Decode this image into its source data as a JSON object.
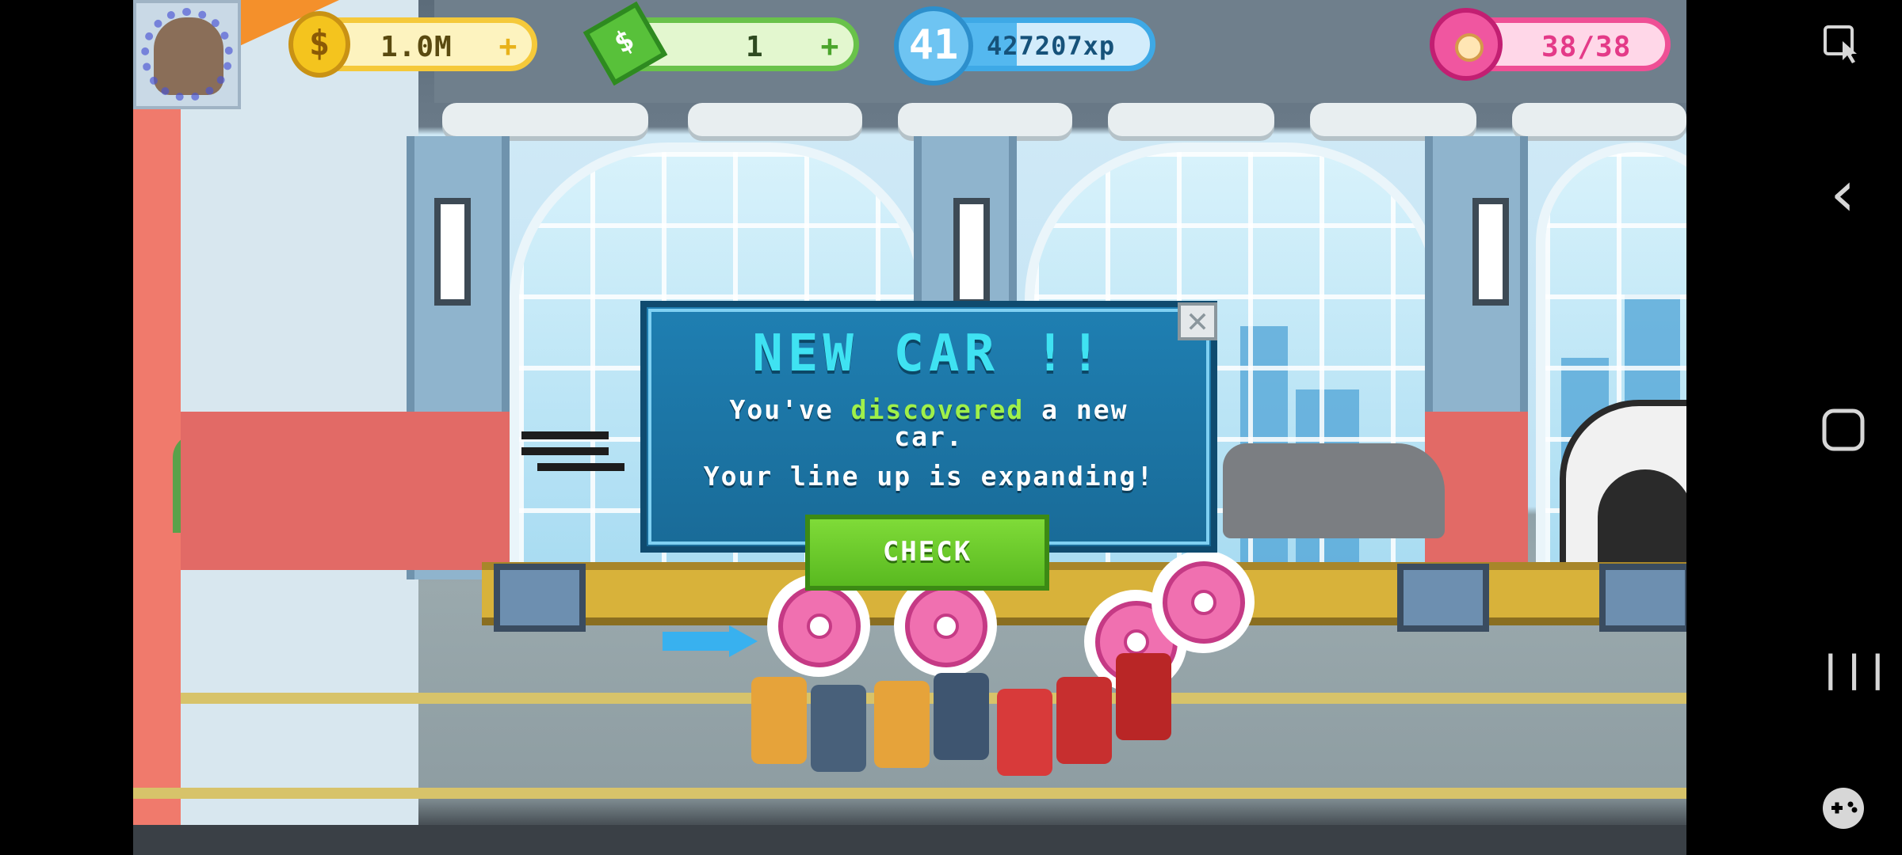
{
  "hud": {
    "coins": "1.0M",
    "cash": "1",
    "level": "41",
    "xp": "427207xp",
    "xp_progress": 0.45,
    "donuts": "38/38",
    "plus": "+"
  },
  "dialog": {
    "title": "NEW CAR !!",
    "line1_pre": "You've ",
    "line1_highlight": "discovered",
    "line1_post": " a new",
    "line2": "car.",
    "line3": "Your line up is expanding!",
    "check_label": "CHECK",
    "close_glyph": "✕"
  },
  "nav": {
    "back_glyph": "‹",
    "home_glyph": "▢",
    "recents_glyph": "|||"
  },
  "colors": {
    "coin": "#f5c93a",
    "cash": "#69c24a",
    "xp": "#3ea9e6",
    "donut": "#ef4f95",
    "dialog": "#1f7fb2",
    "check": "#59b920"
  },
  "icons": [
    "avatar-icon",
    "coin-icon",
    "cash-icon",
    "level-badge-icon",
    "donut-icon",
    "screenshot-tool-icon",
    "back-icon",
    "home-icon",
    "recents-icon",
    "game-controller-icon"
  ]
}
